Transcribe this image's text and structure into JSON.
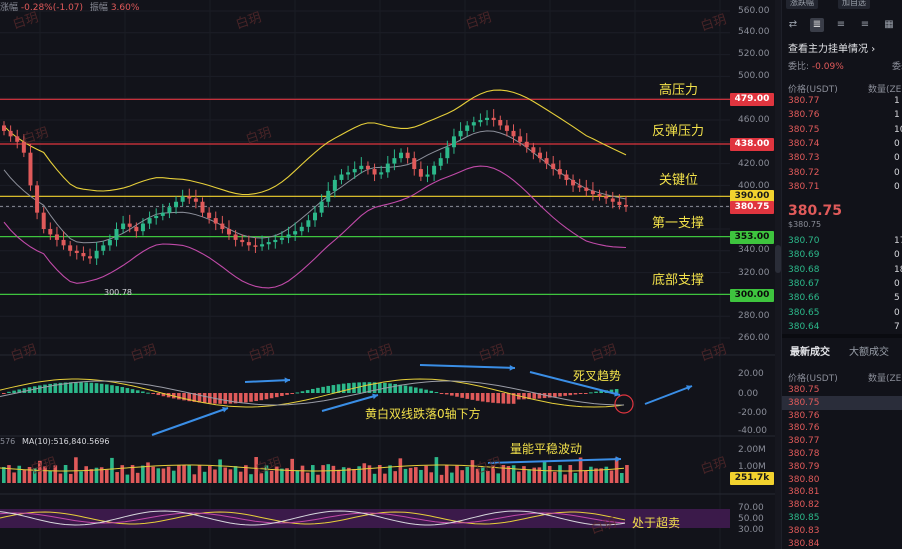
{
  "header": {
    "change_label": "涨幅",
    "change_value": "-0.28%(-1.07)",
    "amplitude_label": "振幅",
    "amplitude_value": "3.60%"
  },
  "price_axis": {
    "labels": [
      "560.00",
      "540.00",
      "520.00",
      "500.00",
      "460.00",
      "420.00",
      "400.00",
      "340.00",
      "320.00",
      "280.00",
      "260.00"
    ],
    "tags": [
      {
        "text": "479.00",
        "bg": "#e0353f",
        "fg": "#ffffff"
      },
      {
        "text": "438.00",
        "bg": "#e0353f",
        "fg": "#ffffff"
      },
      {
        "text": "390.00",
        "bg": "#f2d22e",
        "fg": "#1a1a1a"
      },
      {
        "text": "380.75",
        "bg": "#e0353f",
        "fg": "#ffffff"
      },
      {
        "text": "353.00",
        "bg": "#3ec43e",
        "fg": "#0b0b0b"
      },
      {
        "text": "300.00",
        "bg": "#3ec43e",
        "fg": "#0b0b0b"
      }
    ]
  },
  "annotations": {
    "high_pressure": "高压力",
    "rebound_pressure": "反弹压力",
    "key_level": "关键位",
    "first_support": "第一支撑",
    "bottom_support": "底部支撑",
    "low_price_marker": "300.78",
    "death_cross": "死叉趋势",
    "macd_note": "黄白双线跌落0轴下方",
    "volume_note": "量能平稳波动",
    "oversold": "处于超卖"
  },
  "macd_axis": [
    "20.00",
    "0.00",
    "-20.00",
    "-40.00"
  ],
  "volume_axis": {
    "labels": [
      "2.00M",
      "1.00M"
    ],
    "tag": "251.7k"
  },
  "volume_ma_label": "MA(10):516,840.5696",
  "volume_prefix": "576",
  "rsi_axis": [
    "70.00",
    "50.00",
    "30.00"
  ],
  "watermark": "白玥",
  "colors": {
    "up": "#2cb88a",
    "down": "#e05a5a",
    "accent": "#f2d22e"
  },
  "right_panel": {
    "top_tabs": [
      "涨跌幅",
      "加自选"
    ],
    "title": "查看主力挂单情况",
    "ratio_label": "委比:",
    "ratio_value": "-0.09%",
    "ratio_right": "委差",
    "book_header_price": "价格(USDT)",
    "book_header_qty": "数量(ZE",
    "asks": [
      {
        "price": "380.77",
        "qty": "1"
      },
      {
        "price": "380.76",
        "qty": "1"
      },
      {
        "price": "380.75",
        "qty": "10"
      },
      {
        "price": "380.74",
        "qty": "0"
      },
      {
        "price": "380.73",
        "qty": "0"
      },
      {
        "price": "380.72",
        "qty": "0"
      },
      {
        "price": "380.71",
        "qty": "0"
      }
    ],
    "last_price": "380.75",
    "last_price_usd": "$380.75",
    "bids": [
      {
        "price": "380.70",
        "qty": "17"
      },
      {
        "price": "380.69",
        "qty": "0"
      },
      {
        "price": "380.68",
        "qty": "18"
      },
      {
        "price": "380.67",
        "qty": "0"
      },
      {
        "price": "380.66",
        "qty": "5"
      },
      {
        "price": "380.65",
        "qty": "0"
      },
      {
        "price": "380.64",
        "qty": "7"
      }
    ],
    "trade_tabs": [
      "最新成交",
      "大额成交"
    ],
    "trade_header_price": "价格(USDT)",
    "trade_header_qty": "数量(ZE",
    "trades": [
      {
        "price": "380.75",
        "side": "down"
      },
      {
        "price": "380.75",
        "side": "down"
      },
      {
        "price": "380.76",
        "side": "down"
      },
      {
        "price": "380.76",
        "side": "down"
      },
      {
        "price": "380.77",
        "side": "down"
      },
      {
        "price": "380.78",
        "side": "down"
      },
      {
        "price": "380.79",
        "side": "down"
      },
      {
        "price": "380.80",
        "side": "down"
      },
      {
        "price": "380.81",
        "side": "down"
      },
      {
        "price": "380.82",
        "side": "down"
      },
      {
        "price": "380.85",
        "side": "up"
      },
      {
        "price": "380.83",
        "side": "down"
      },
      {
        "price": "380.84",
        "side": "down"
      }
    ]
  }
}
